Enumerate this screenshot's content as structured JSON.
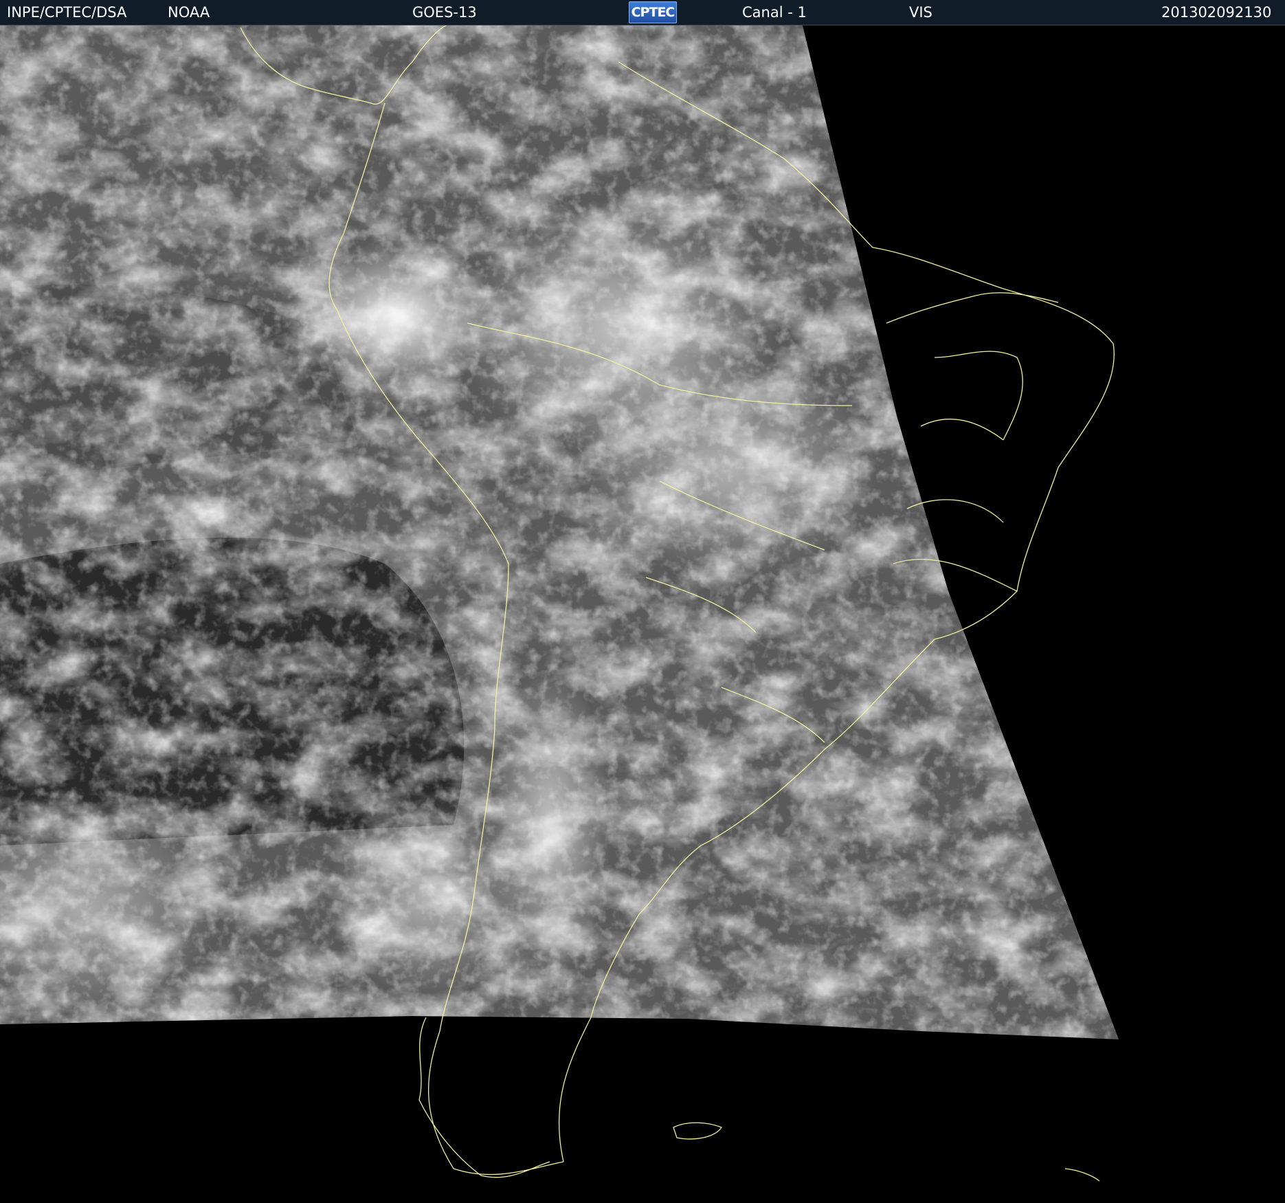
{
  "header": {
    "agency": "INPE/CPTEC/DSA",
    "source": "NOAA",
    "satellite": "GOES-13",
    "logo_text": "CPTEC",
    "channel": "Canal - 1",
    "band": "VIS",
    "timestamp": "201302092130"
  },
  "image": {
    "background_color": "#000000",
    "header_color": "#101c28",
    "border_color": "#f0f0a0"
  }
}
